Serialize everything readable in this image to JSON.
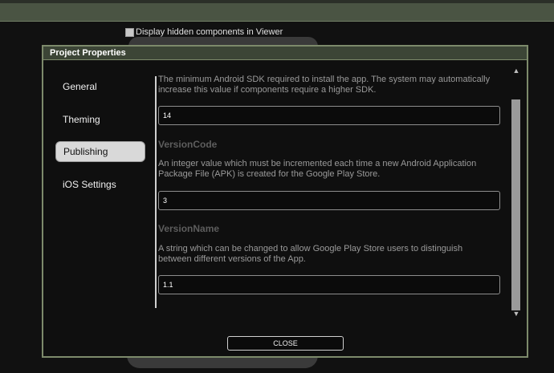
{
  "top_toggle": {
    "label": "Display hidden components in Viewer"
  },
  "dialog": {
    "title": "Project Properties",
    "nav": [
      {
        "label": "General"
      },
      {
        "label": "Theming"
      },
      {
        "label": "Publishing"
      },
      {
        "label": "iOS Settings"
      }
    ],
    "active_nav": "Publishing",
    "min_sdk": {
      "description": "The minimum Android SDK required to install the app. The system may automatically increase this value if components require a higher SDK.",
      "value": "14"
    },
    "version_code": {
      "title": "VersionCode",
      "description": "An integer value which must be incremented each time a new Android Application Package File (APK) is created for the Google Play Store.",
      "value": "3"
    },
    "version_name": {
      "title": "VersionName",
      "description": "A string which can be changed to allow Google Play Store users to distinguish between different versions of the App.",
      "value": "1.1"
    },
    "close_label": "CLOSE"
  }
}
